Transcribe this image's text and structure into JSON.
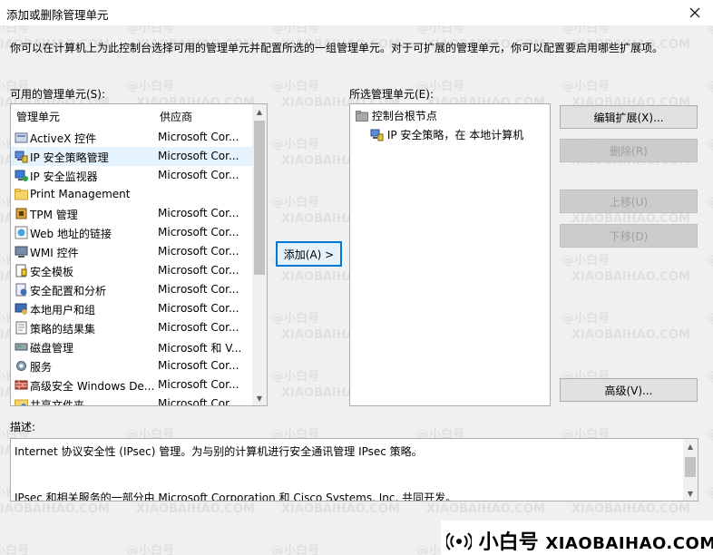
{
  "window": {
    "title": "添加或删除管理单元"
  },
  "intro": "你可以在计算机上为此控制台选择可用的管理单元并配置所选的一组管理单元。对于可扩展的管理单元，你可以配置要启用哪些扩展项。",
  "available": {
    "label": "可用的管理单元(S):",
    "col_name": "管理单元",
    "col_vendor": "供应商",
    "items": [
      {
        "name": "ActiveX 控件",
        "vendor": "Microsoft Cor...",
        "icon": "activex-icon"
      },
      {
        "name": "IP 安全策略管理",
        "vendor": "Microsoft Cor...",
        "icon": "ip-security-policy-icon",
        "selected": true
      },
      {
        "name": "IP 安全监视器",
        "vendor": "Microsoft Cor...",
        "icon": "ip-security-monitor-icon"
      },
      {
        "name": "Print Management",
        "vendor": "",
        "icon": "folder-icon"
      },
      {
        "name": "TPM 管理",
        "vendor": "Microsoft Cor...",
        "icon": "tpm-icon"
      },
      {
        "name": "Web 地址的链接",
        "vendor": "Microsoft Cor...",
        "icon": "web-link-icon"
      },
      {
        "name": "WMI 控件",
        "vendor": "Microsoft Cor...",
        "icon": "wmi-icon"
      },
      {
        "name": "安全模板",
        "vendor": "Microsoft Cor...",
        "icon": "security-template-icon"
      },
      {
        "name": "安全配置和分析",
        "vendor": "Microsoft Cor...",
        "icon": "security-config-icon"
      },
      {
        "name": "本地用户和组",
        "vendor": "Microsoft Cor...",
        "icon": "users-groups-icon"
      },
      {
        "name": "策略的结果集",
        "vendor": "Microsoft Cor...",
        "icon": "rsop-icon"
      },
      {
        "name": "磁盘管理",
        "vendor": "Microsoft 和 V...",
        "icon": "disk-icon"
      },
      {
        "name": "服务",
        "vendor": "Microsoft Cor...",
        "icon": "gear-icon"
      },
      {
        "name": "高级安全 Windows De...",
        "vendor": "Microsoft Cor...",
        "icon": "firewall-icon"
      },
      {
        "name": "共享文件夹",
        "vendor": "Microsoft Cor...",
        "icon": "shared-folder-icon"
      }
    ]
  },
  "add_button": "添加(A) >",
  "selected": {
    "label": "所选管理单元(E):",
    "root": "控制台根节点",
    "child": "IP 安全策略，在 本地计算机"
  },
  "buttons": {
    "edit_ext": "编辑扩展(X)...",
    "remove": "删除(R)",
    "move_up": "上移(U)",
    "move_down": "下移(D)",
    "advanced": "高级(V)..."
  },
  "description": {
    "label": "描述:",
    "line1": "Internet 协议安全性 (IPsec) 管理。为与别的计算机进行安全通讯管理 IPsec 策略。",
    "line2": "IPsec 和相关服务的一部分由 Microsoft Corporation 和 Cisco Systems, Inc. 共同开发。"
  },
  "watermark": {
    "cn": "小白号",
    "en": "XIAOBAIHAO.COM",
    "bg": "@小白号"
  },
  "colors": {
    "accent": "#0078d7",
    "selection": "#e5f3ff",
    "window_bg": "#f0f0f0"
  }
}
